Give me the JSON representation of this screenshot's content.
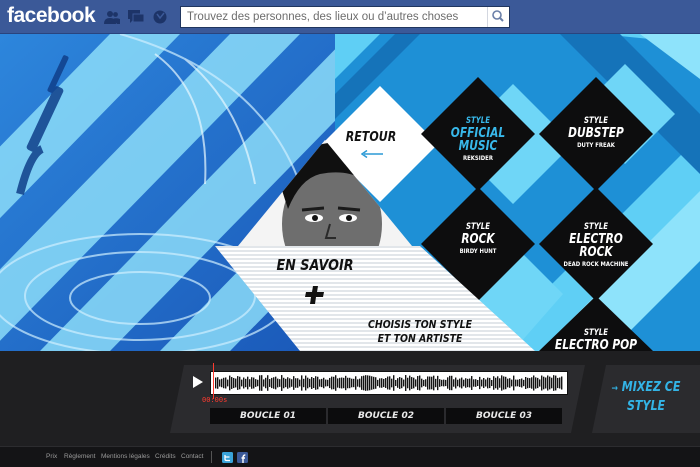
{
  "facebook": {
    "logo": "facebook",
    "search_placeholder": "Trouvez des personnes, des lieux ou d’autres choses",
    "icons": [
      "friend-requests-icon",
      "messages-icon",
      "notifications-icon",
      "search-icon"
    ]
  },
  "nav": {
    "retour": "RETOUR",
    "en_savoir": "EN SAVOIR",
    "tagline_line1": "CHOISIS TON STYLE",
    "tagline_line2": "ET TON ARTISTE"
  },
  "styles": [
    {
      "label": "STYLE",
      "name": "OFFICIAL MUSIC",
      "artist": "REKSIDER",
      "active": true
    },
    {
      "label": "STYLE",
      "name": "DUBSTEP",
      "artist": "DUTY FREAK",
      "active": false
    },
    {
      "label": "STYLE",
      "name": "ROCK",
      "artist": "BIRDY HUNT",
      "active": false
    },
    {
      "label": "STYLE",
      "name": "ELECTRO ROCK",
      "artist": "DEAD ROCK MACHINE",
      "active": false
    },
    {
      "label": "STYLE",
      "name": "ELECTRO POP",
      "artist": "",
      "active": false
    }
  ],
  "player": {
    "time": "00:00s",
    "progress": 0.0,
    "loops": [
      "BOUCLE 01",
      "BOUCLE 02",
      "BOUCLE 03"
    ],
    "mix_line1": "MIXEZ CE",
    "mix_line2": "STYLE"
  },
  "footer": {
    "links": [
      "Prix",
      "Règlement",
      "Mentions légales",
      "Crédits",
      "Contact"
    ],
    "social_icons": [
      "twitter-icon",
      "facebook-icon"
    ]
  },
  "colors": {
    "facebook_blue": "#3b5998",
    "accent_cyan": "#38b8ea",
    "light_cyan": "#7fd8f7",
    "deep_blue": "#1e62c4",
    "diamond_dark": "#0d0d0e",
    "playhead_red": "#ff3b2f"
  }
}
